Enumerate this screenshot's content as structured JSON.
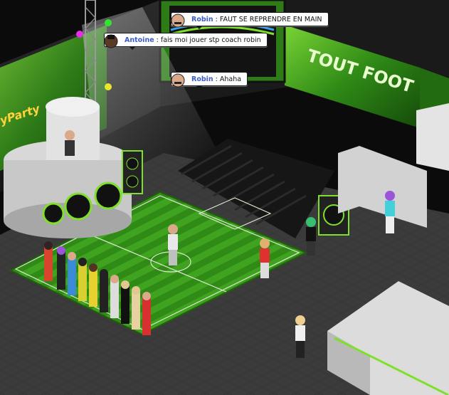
{
  "room": {
    "sign_text": "TOUT FOOT",
    "dj_banner_text": "yParty"
  },
  "chat": [
    {
      "user": "Robin",
      "message": "FAUT SE REPRENDRE EN MAIN",
      "avatar_icon": "robin-head-icon"
    },
    {
      "user": "Antoine",
      "message": "fais moi jouer stp coach robin",
      "avatar_icon": "antoine-head-icon"
    },
    {
      "user": "Robin",
      "message": "Ahaha",
      "avatar_icon": "robin-head-icon"
    }
  ],
  "colors": {
    "grass_dark": "#2f8a16",
    "grass_light": "#3fa31f",
    "accent_green": "#7ee02a",
    "floor": "#3a3a3a",
    "wall": "#1d1d1d",
    "username": "#3e5cc8"
  }
}
